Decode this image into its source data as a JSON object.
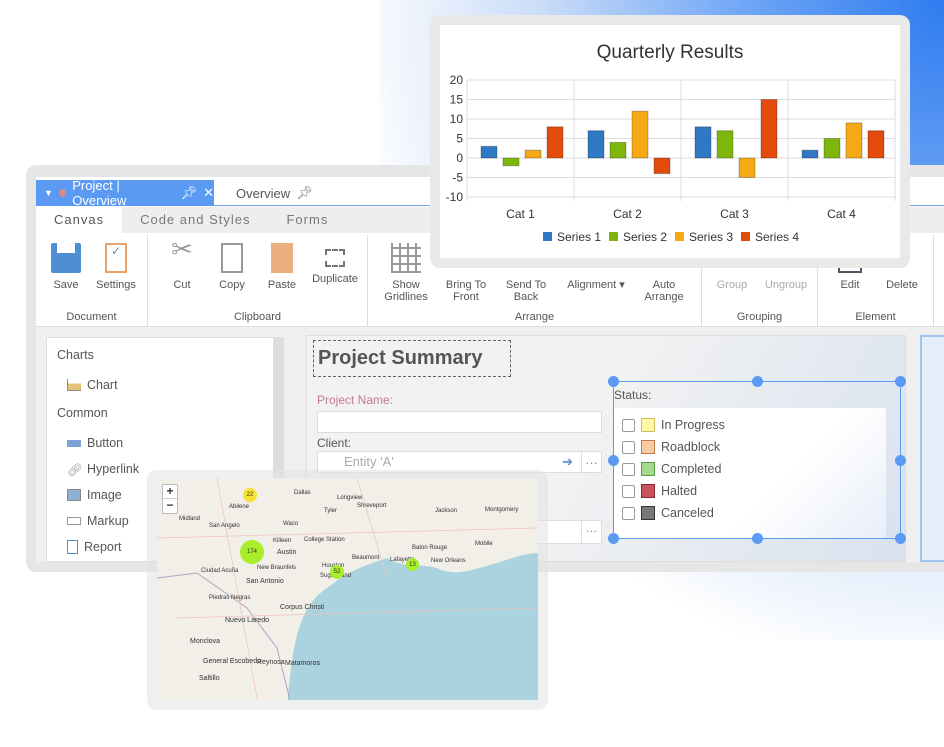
{
  "tabs": {
    "doc_tab": "Project | Overview",
    "second_tab": "Overview"
  },
  "ribbon_tabs": [
    {
      "label": "Canvas",
      "active": true
    },
    {
      "label": "Code and Styles"
    },
    {
      "label": "Forms"
    }
  ],
  "ribbon": {
    "document": {
      "label": "Document",
      "buttons": [
        "Save",
        "Settings"
      ]
    },
    "clipboard": {
      "label": "Clipboard",
      "buttons": [
        "Cut",
        "Copy",
        "Paste",
        "Duplicate"
      ]
    },
    "arrange": {
      "label": "Arrange",
      "buttons": [
        "Show Gridlines",
        "Bring To Front",
        "Send To Back",
        "Alignment ▾",
        "Auto Arrange"
      ]
    },
    "grouping": {
      "label": "Grouping",
      "buttons": [
        "Group",
        "Ungroup"
      ]
    },
    "element": {
      "label": "Element",
      "buttons": [
        "Edit",
        "Delete"
      ]
    }
  },
  "sidebar": {
    "sections": [
      {
        "title": "Charts",
        "items": [
          "Chart"
        ]
      },
      {
        "title": "Common",
        "items": [
          "Button",
          "Hyperlink",
          "Image",
          "Markup",
          "Report"
        ]
      }
    ]
  },
  "form": {
    "title": "Project Summary",
    "project_name_label": "Project Name:",
    "project_name_value": "",
    "client_label": "Client:",
    "client_value": "Entity 'A'",
    "status_label": "Status:",
    "statuses": [
      {
        "label": "In Progress",
        "color": "#fff9a8",
        "checked": false
      },
      {
        "label": "Roadblock",
        "color": "#f7c9a4",
        "checked": false
      },
      {
        "label": "Completed",
        "color": "#a2dc8c",
        "checked": false
      },
      {
        "label": "Halted",
        "color": "#c9535a",
        "checked": false
      },
      {
        "label": "Canceled",
        "color": "#777777",
        "checked": false
      }
    ]
  },
  "chart_data": {
    "type": "bar",
    "title": "Quarterly Results",
    "categories": [
      "Cat 1",
      "Cat 2",
      "Cat 3",
      "Cat 4"
    ],
    "ylim": [
      -10,
      20
    ],
    "yticks": [
      20,
      15,
      10,
      5,
      0,
      -5,
      -10
    ],
    "grid": true,
    "legend": "bottom",
    "series": [
      {
        "name": "Series 1",
        "color": "#2f78c4",
        "values": [
          3,
          7,
          8,
          2
        ]
      },
      {
        "name": "Series 2",
        "color": "#7fb60e",
        "values": [
          -2,
          4,
          7,
          5
        ]
      },
      {
        "name": "Series 3",
        "color": "#f5a914",
        "values": [
          2,
          12,
          -5,
          9
        ]
      },
      {
        "name": "Series 4",
        "color": "#e24b0d",
        "values": [
          8,
          -4,
          15,
          7
        ]
      }
    ]
  },
  "map": {
    "zoom_in": "+",
    "zoom_out": "−",
    "clusters": [
      {
        "count": "22",
        "color": "#f5e330"
      },
      {
        "count": "174",
        "color": "#a8ee2a"
      },
      {
        "count": "52",
        "color": "#a8ee2a"
      },
      {
        "count": "13",
        "color": "#a8ee2a"
      }
    ],
    "cities": [
      "Dallas",
      "Abilene",
      "Midland",
      "San Angelo",
      "Waco",
      "Killeen",
      "Austin",
      "New Braunfels",
      "San Antonio",
      "College Station",
      "Houston",
      "Sugar Land",
      "Beaumont",
      "Lafayette",
      "Baton Rouge",
      "New Orleans",
      "Jackson",
      "Shreveport",
      "Longview",
      "Tyler",
      "Mobile",
      "Montgomery",
      "Ciudad Acuña",
      "Piedras Negras",
      "Nuevo Laredo",
      "Corpus Christi",
      "Monclova",
      "General Escobedo",
      "Reynosa",
      "Matamoros",
      "Saltillo"
    ]
  }
}
